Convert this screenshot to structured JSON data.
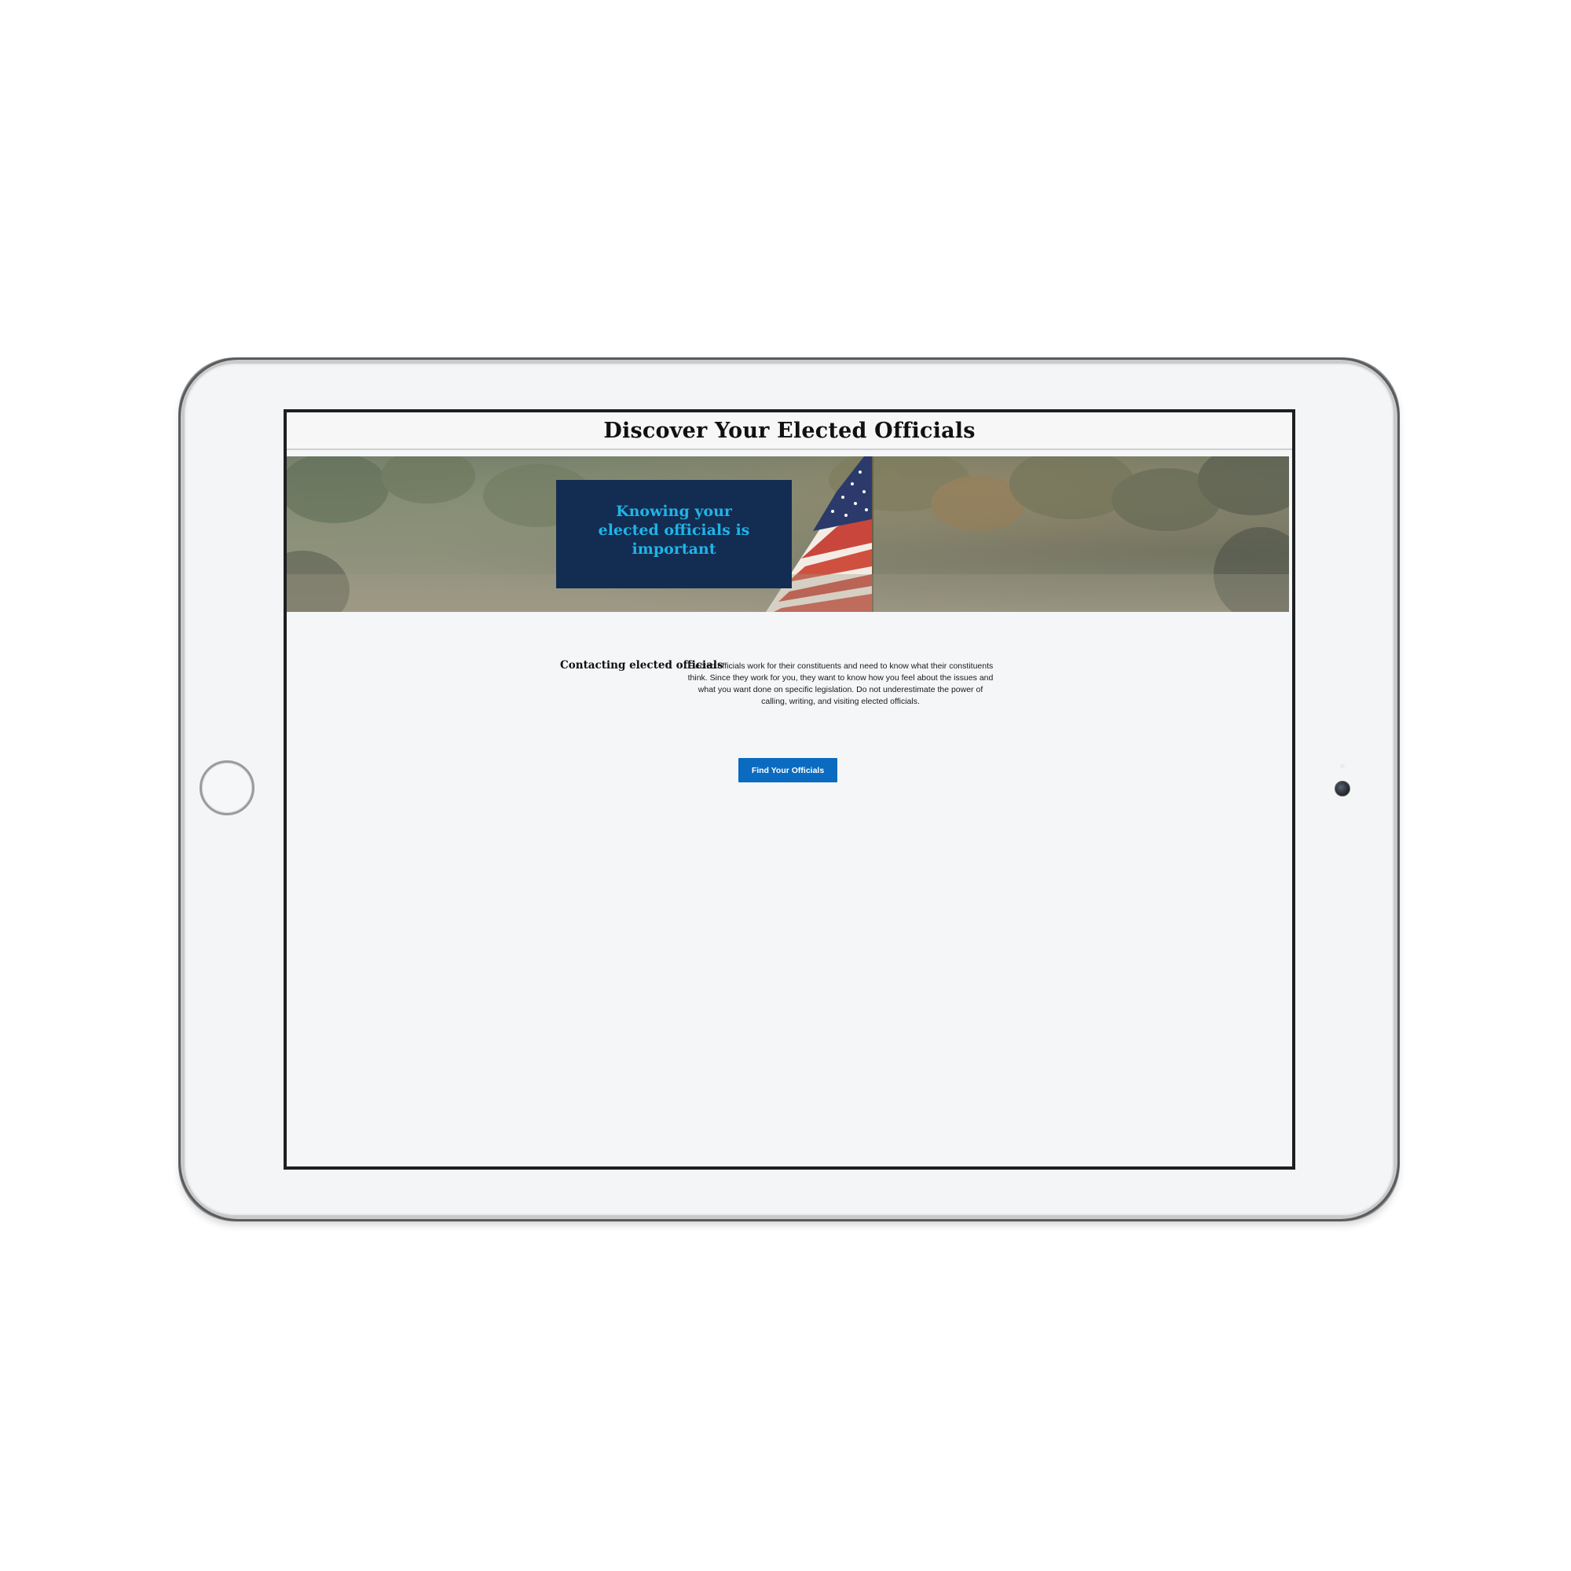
{
  "site": {
    "title": "Discover Your Elected Officials"
  },
  "hero": {
    "heading": "Knowing your elected officials is important",
    "box_color": "#132c52",
    "heading_color": "#1fb4e6"
  },
  "content": {
    "section_title": "Contacting elected officials",
    "body": "Elected officials work for their constituents and need to know what their constituents think. Since they work for you, they want to know how you feel about the issues and what you want done on specific legislation. Do not underestimate the power of calling, writing, and visiting elected officials."
  },
  "actions": {
    "find_button_label": "Find Your Officials",
    "button_color": "#0a6bc1"
  },
  "icons": {
    "home_button": "home-button-icon",
    "camera": "camera-icon"
  }
}
